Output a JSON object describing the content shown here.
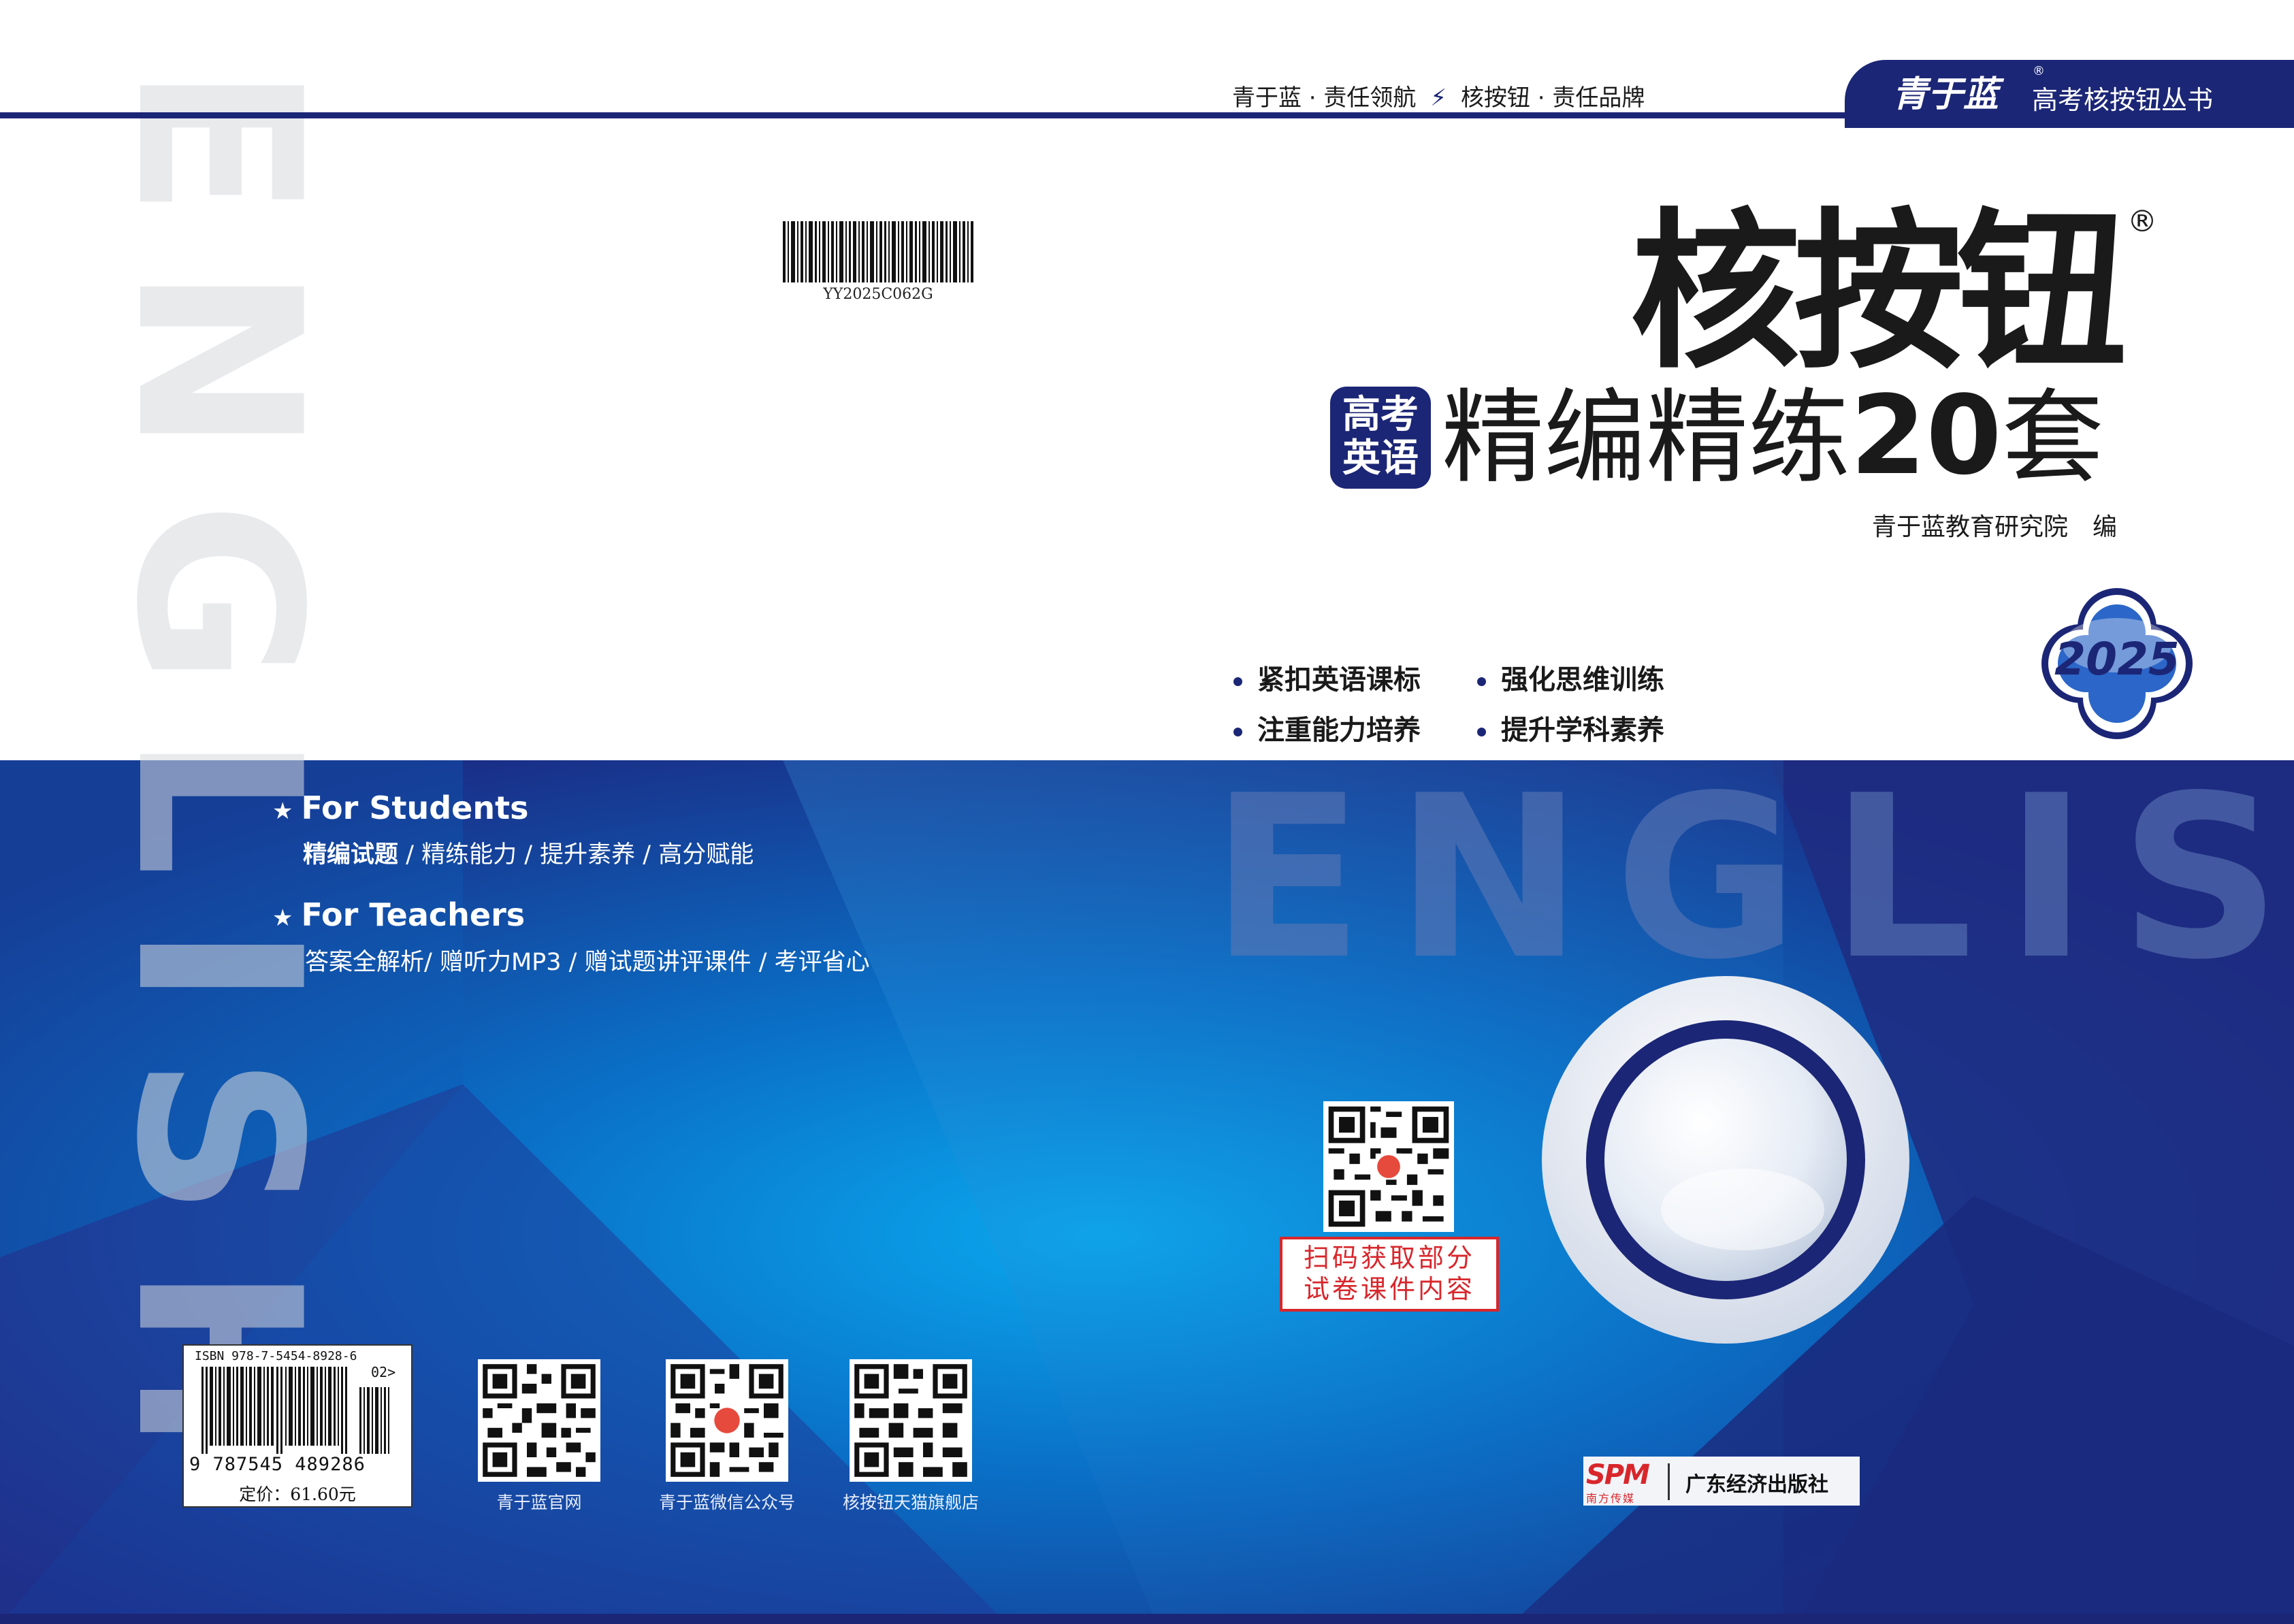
{
  "header": {
    "slogan_part1": "青于蓝 · 责任领航",
    "slogan_part2": "核按钮 · 责任品牌",
    "logo_text": "青于蓝",
    "registered_mark": "®",
    "series_name": "高考核按钮丛书"
  },
  "barcode_top": {
    "code": "YY2025C062G"
  },
  "title": {
    "main": "核按钮",
    "registered_mark": "®"
  },
  "subtitle": {
    "box_line1": "高考",
    "box_line2": "英语",
    "text": "精编精练",
    "number": "20",
    "suffix": "套"
  },
  "editor": "青于蓝教育研究院　编",
  "year_badge": "2025",
  "features": [
    "紧扣英语课标",
    "强化思维训练",
    "注重能力培养",
    "提升学科素养"
  ],
  "background_words": {
    "vertical": "ENGLISH",
    "horizontal": "ENGLISH"
  },
  "for_students": {
    "heading": "For Students",
    "items": [
      "精编试题",
      "精练能力",
      "提升素养",
      "高分赋能"
    ]
  },
  "for_teachers": {
    "heading": "For Teachers",
    "items": [
      "答案全解析",
      "赠听力MP3",
      "赠试题讲评课件",
      "考评省心"
    ]
  },
  "scan_prompt": {
    "line1": "扫码获取部分",
    "line2": "试卷课件内容"
  },
  "qr_codes": [
    {
      "label": "青于蓝官网"
    },
    {
      "label": "青于蓝微信公众号"
    },
    {
      "label": "核按钮天猫旗舰店"
    }
  ],
  "isbn": {
    "top_text": "ISBN 978-7-5454-8928-6",
    "addon": "02>",
    "number_text": "9 787545 489286",
    "price": "定价：61.60元"
  },
  "publisher": {
    "logo": "SPM",
    "logo_sub": "南方传媒",
    "name": "广东经济出版社"
  },
  "colors": {
    "navy": "#1c2676",
    "blue": "#0b74c8",
    "accent_red": "#d8262b"
  }
}
